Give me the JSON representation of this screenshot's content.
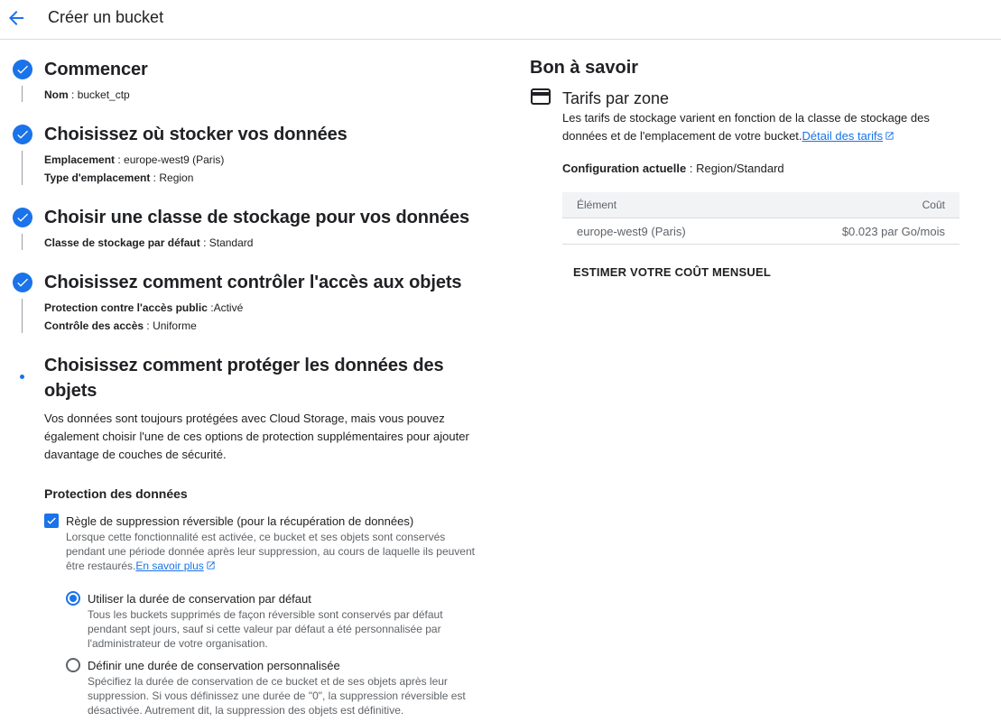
{
  "header": {
    "title": "Créer un bucket",
    "back_icon": "arrow-back-icon"
  },
  "steps": [
    {
      "title": "Commencer",
      "fields": [
        {
          "label": "Nom",
          "sep": " : ",
          "value": "bucket_ctp"
        }
      ]
    },
    {
      "title": "Choisissez où stocker vos données",
      "fields": [
        {
          "label": "Emplacement",
          "sep": " : ",
          "value": "europe-west9 (Paris)"
        },
        {
          "label": "Type d'emplacement",
          "sep": " : ",
          "value": "Region"
        }
      ]
    },
    {
      "title": "Choisir une classe de stockage pour vos données",
      "fields": [
        {
          "label": "Classe de stockage par défaut",
          "sep": " : ",
          "value": "Standard"
        }
      ]
    },
    {
      "title": "Choisissez comment contrôler l'accès aux objets",
      "fields": [
        {
          "label": "Protection contre l'accès public",
          "sep": " :",
          "value": "Activé"
        },
        {
          "label": "Contrôle des accès",
          "sep": " : ",
          "value": "Uniforme"
        }
      ]
    },
    {
      "title_line1": "Choisissez comment protéger les données des",
      "title_line2": "objets",
      "description": "Vos données sont toujours protégées avec Cloud Storage, mais vous pouvez également choisir l'une de ces options de protection supplémentaires pour ajouter davantage de couches de sécurité."
    }
  ],
  "data_protection": {
    "heading": "Protection des données",
    "soft_delete": {
      "checked": true,
      "label": "Règle de suppression réversible (pour la récupération de données)",
      "help": "Lorsque cette fonctionnalité est activée, ce bucket et ses objets sont conservés pendant une période donnée après leur suppression, au cours de laquelle ils peuvent être restaurés.",
      "link": "En savoir plus"
    },
    "retention_options": [
      {
        "selected": true,
        "label": "Utiliser la durée de conservation par défaut",
        "help": "Tous les buckets supprimés de façon réversible sont conservés par défaut pendant sept jours, sauf si cette valeur par défaut a été personnalisée par l'administrateur de votre organisation."
      },
      {
        "selected": false,
        "label": "Définir une durée de conservation personnalisée",
        "help": "Spécifiez la durée de conservation de ce bucket et de ses objets après leur suppression. Si vous définissez une durée de \"0\", la suppression réversible est désactivée. Autrement dit, la suppression des objets est définitive."
      }
    ]
  },
  "sidebar": {
    "title": "Bon à savoir",
    "pricing": {
      "icon": "credit-card-icon",
      "title": "Tarifs par zone",
      "description": "Les tarifs de stockage varient en fonction de la classe de stockage des données et de l'emplacement de votre bucket.",
      "link": "Détail des tarifs",
      "config_label": "Configuration actuelle",
      "config_sep": " : ",
      "config_value": "Region/Standard",
      "table": {
        "headers": [
          "Élément",
          "Coût"
        ],
        "rows": [
          [
            "europe-west9 (Paris)",
            "$0.023 par Go/mois"
          ]
        ]
      },
      "estimate_button": "ESTIMER VOTRE COÛT MENSUEL"
    }
  },
  "colors": {
    "accent": "#1a73e8",
    "text": "#202124",
    "muted": "#5f6368",
    "divider": "#dadce0"
  }
}
